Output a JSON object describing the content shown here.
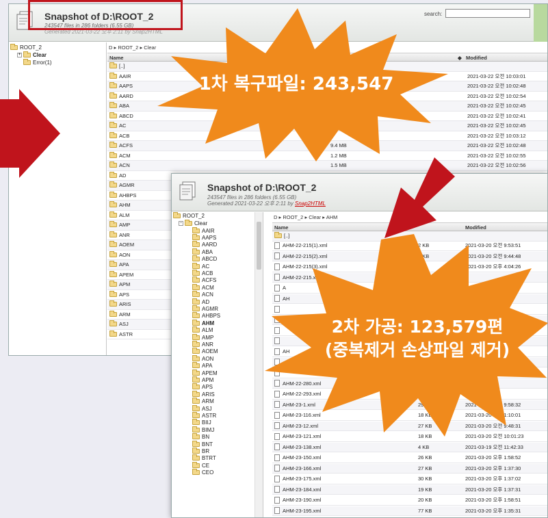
{
  "window1": {
    "title": "Snapshot of D:\\ROOT_2",
    "stats": "243547 files in 286 folders (6.55 GB)",
    "generated": "Generated 2021-03-22 오후 2:11 by Snap2HTML",
    "search_label": "search:",
    "search_value": "",
    "tree": {
      "root": "ROOT_2",
      "items": [
        {
          "label": "Clear",
          "expander": "+"
        },
        {
          "label": "Error(1)",
          "expander": ""
        }
      ]
    },
    "breadcrumb": "D ▸ ROOT_2 ▸ Clear",
    "columns": {
      "name": "Name",
      "size": "Size",
      "modified": "Modified",
      "sort_glyph": "◆"
    },
    "up_label": "[..]",
    "rows": [
      {
        "name": "AAIR",
        "size": "",
        "modified": "2021-03-22 오전 10:03:01"
      },
      {
        "name": "AAPS",
        "size": "",
        "modified": "2021-03-22 오전 10:02:48"
      },
      {
        "name": "AARD",
        "size": "",
        "modified": "2021-03-22 오전 10:02:54"
      },
      {
        "name": "ABA",
        "size": "",
        "modified": "2021-03-22 오전 10:02:45"
      },
      {
        "name": "ABCD",
        "size": "",
        "modified": "2021-03-22 오전 10:02:41"
      },
      {
        "name": "AC",
        "size": "",
        "modified": "2021-03-22 오전 10:02:45"
      },
      {
        "name": "ACB",
        "size": "",
        "modified": "2021-03-22 오전 10:03:12"
      },
      {
        "name": "ACFS",
        "size": "9.4 MB",
        "modified": "2021-03-22 오전 10:02:48"
      },
      {
        "name": "ACM",
        "size": "1.2 MB",
        "modified": "2021-03-22 오전 10:02:55"
      },
      {
        "name": "ACN",
        "size": "1.5 MB",
        "modified": "2021-03-22 오전 10:02:56"
      },
      {
        "name": "AD",
        "size": "",
        "modified": ""
      },
      {
        "name": "AGMR",
        "size": "",
        "modified": ""
      },
      {
        "name": "AHBPS",
        "size": "",
        "modified": ""
      },
      {
        "name": "AHM",
        "size": "",
        "modified": ""
      },
      {
        "name": "ALM",
        "size": "",
        "modified": ""
      },
      {
        "name": "AMP",
        "size": "",
        "modified": ""
      },
      {
        "name": "ANR",
        "size": "",
        "modified": ""
      },
      {
        "name": "AOEM",
        "size": "",
        "modified": ""
      },
      {
        "name": "AON",
        "size": "",
        "modified": ""
      },
      {
        "name": "APA",
        "size": "",
        "modified": ""
      },
      {
        "name": "APEM",
        "size": "",
        "modified": ""
      },
      {
        "name": "APM",
        "size": "",
        "modified": ""
      },
      {
        "name": "APS",
        "size": "",
        "modified": ""
      },
      {
        "name": "ARIS",
        "size": "",
        "modified": ""
      },
      {
        "name": "ARM",
        "size": "",
        "modified": ""
      },
      {
        "name": "ASJ",
        "size": "",
        "modified": ""
      },
      {
        "name": "ASTR",
        "size": "",
        "modified": ""
      }
    ]
  },
  "window2": {
    "title": "Snapshot of D:\\ROOT_2",
    "stats": "243547 files in 286 folders (6.55 GB)",
    "generated_prefix": "Generated 2021-03-22 오후 2:11 by ",
    "generated_link": "Snap2HTML",
    "tree_root": "ROOT_2",
    "tree_clear": "Clear",
    "tree_items": [
      "AAIR",
      "AAPS",
      "AARD",
      "ABA",
      "ABCD",
      "AC",
      "ACB",
      "ACFS",
      "ACM",
      "ACN",
      "AD",
      "AGMR",
      "AHBPS",
      "AHM",
      "ALM",
      "AMP",
      "ANR",
      "AOEM",
      "AON",
      "APA",
      "APEM",
      "APM",
      "APS",
      "ARIS",
      "ARM",
      "ASJ",
      "ASTR",
      "BIIJ",
      "BIMJ",
      "BN",
      "BNT",
      "BR",
      "BTRT",
      "CE",
      "CEO"
    ],
    "tree_selected": "AHM",
    "breadcrumb": "D ▸ ROOT_2 ▸ Clear ▸ AHM",
    "columns": {
      "name": "Name",
      "modified": "Modified"
    },
    "up_label": "[..]",
    "rows": [
      {
        "name": "AHM-22-215(1).xml",
        "size": "2 KB",
        "modified": "2021-03-20 오전 9:53:51"
      },
      {
        "name": "AHM-22-215(2).xml",
        "size": "3 KB",
        "modified": "2021-03-20 오전 9:44:48"
      },
      {
        "name": "AHM-22-215(3).xml",
        "size": "",
        "modified": "2021-03-20 오후 4:04:26"
      },
      {
        "name": "AHM-22-215.xml",
        "size": "",
        "modified": ""
      },
      {
        "name": "A",
        "size": "",
        "modified": ""
      },
      {
        "name": "AH",
        "size": "",
        "modified": ""
      },
      {
        "name": "",
        "size": "",
        "modified": ""
      },
      {
        "name": "",
        "size": "",
        "modified": ""
      },
      {
        "name": "",
        "size": "",
        "modified": ""
      },
      {
        "name": "",
        "size": "",
        "modified": ""
      },
      {
        "name": "AH",
        "size": "",
        "modified": ""
      },
      {
        "name": "",
        "size": "",
        "modified": ""
      },
      {
        "name": "",
        "size": "",
        "modified": ""
      },
      {
        "name": "AHM-22-280.xml",
        "size": "",
        "modified": "9:53:51"
      },
      {
        "name": "AHM-22-293.xml",
        "size": "KB",
        "modified": "전 9:53:51"
      },
      {
        "name": "AHM-23-1.xml",
        "size": "29 KB",
        "modified": "2021-03-20 오전 9:58:32"
      },
      {
        "name": "AHM-23-116.xml",
        "size": "18 KB",
        "modified": "2021-03-20 오전 1:10:01"
      },
      {
        "name": "AHM-23-12.xml",
        "size": "27 KB",
        "modified": "2021-03-20 오전 9:48:31"
      },
      {
        "name": "AHM-23-121.xml",
        "size": "18 KB",
        "modified": "2021-03-20 오전 10:01:23"
      },
      {
        "name": "AHM-23-138.xml",
        "size": "4 KB",
        "modified": "2021-03-19 오전 11:42:33"
      },
      {
        "name": "AHM-23-150.xml",
        "size": "26 KB",
        "modified": "2021-03-20 오후 1:58:52"
      },
      {
        "name": "AHM-23-166.xml",
        "size": "27 KB",
        "modified": "2021-03-20 오후 1:37:30"
      },
      {
        "name": "AHM-23-175.xml",
        "size": "30 KB",
        "modified": "2021-03-20 오후 1:37:02"
      },
      {
        "name": "AHM-23-184.xml",
        "size": "19 KB",
        "modified": "2021-03-20 오후 1:37:31"
      },
      {
        "name": "AHM-23-190.xml",
        "size": "20 KB",
        "modified": "2021-03-20 오후 1:58:51"
      },
      {
        "name": "AHM-23-195.xml",
        "size": "77 KB",
        "modified": "2021-03-20 오후 1:35:31"
      }
    ]
  },
  "annotations": {
    "burst1": "1차 복구파일: 243,547",
    "burst2_line1": "2차 가공: 123,579편",
    "burst2_line2": "(중복제거 손상파일 제거)"
  },
  "colors": {
    "burst": "#f08a1c",
    "arrow": "#c0141c",
    "highlight": "#c0141c"
  }
}
